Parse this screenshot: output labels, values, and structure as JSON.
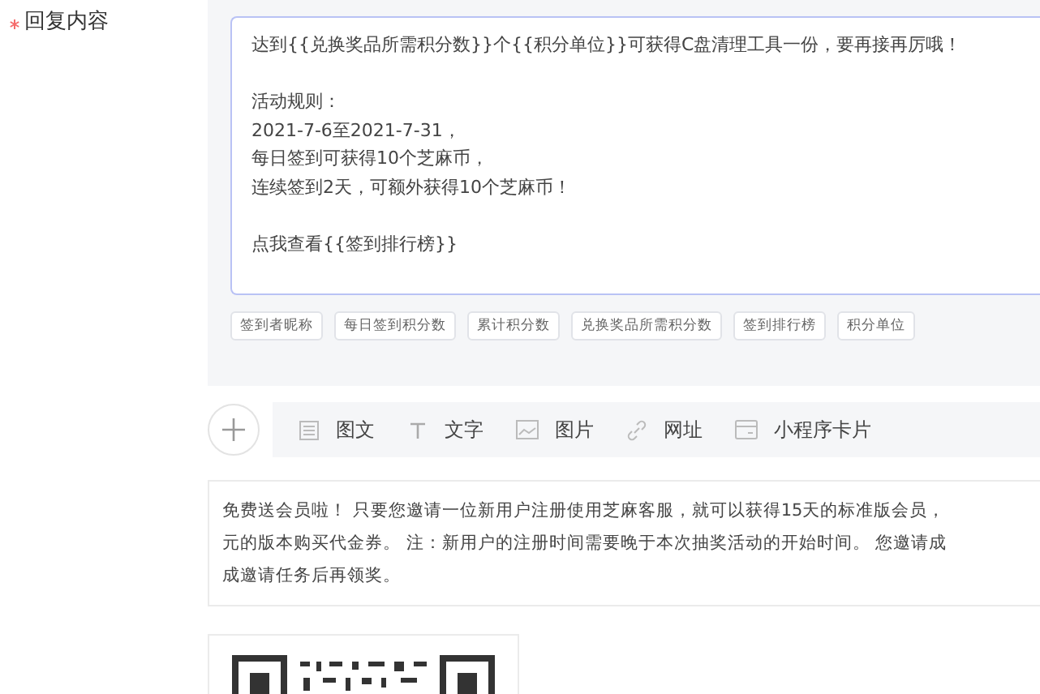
{
  "field": {
    "label": "回复内容",
    "required": true
  },
  "reply_text": {
    "paragraphs": [
      [
        "达到{{兑换奖品所需积分数}}个{{积分单位}}可获得C盘清理工具一份，要再接再厉哦！"
      ],
      [
        "活动规则：",
        "2021-7-6至2021-7-31，",
        "每日签到可获得10个芝麻币，",
        "连续签到2天，可额外获得10个芝麻币！"
      ],
      [
        "点我查看{{签到排行榜}}"
      ]
    ]
  },
  "variable_tags": [
    "签到者昵称",
    "每日签到积分数",
    "累计积分数",
    "兑换奖品所需积分数",
    "签到排行榜",
    "积分单位"
  ],
  "content_types": [
    {
      "kind": "article",
      "label": "图文"
    },
    {
      "kind": "text",
      "label": "文字"
    },
    {
      "kind": "image",
      "label": "图片"
    },
    {
      "kind": "link",
      "label": "网址"
    },
    {
      "kind": "miniprogram",
      "label": "小程序卡片"
    }
  ],
  "notice_lines": [
    "免费送会员啦！ 只要您邀请一位新用户注册使用芝麻客服，就可以获得15天的标准版会员，",
    "元的版本购买代金券。 注：新用户的注册时间需要晚于本次抽奖活动的开始时间。 您邀请成",
    "成邀请任务后再领奖。"
  ]
}
